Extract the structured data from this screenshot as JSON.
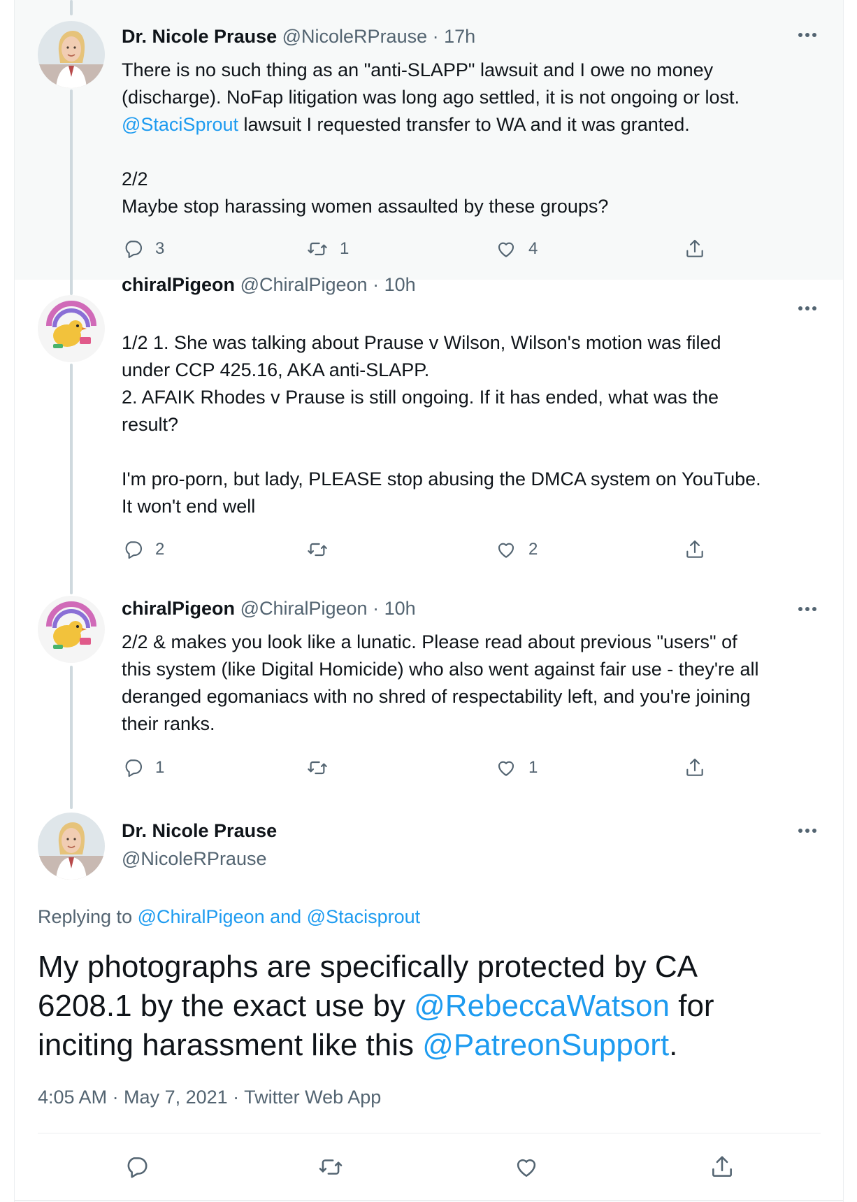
{
  "colors": {
    "link": "#1d9bf0",
    "secondary_text": "#536471",
    "primary_text": "#0f1419",
    "highlight_bg": "#f7f9f9"
  },
  "tweets": [
    {
      "name": "Dr. Nicole Prause",
      "handle": "@NicoleRPrause",
      "separator": "·",
      "time": "17h",
      "text_a": "There is no such thing as an \"anti-SLAPP\" lawsuit and I owe no money\n(discharge). NoFap litigation was long ago settled, it is not ongoing or lost.\n",
      "mention": "@StaciSprout",
      "text_b": " lawsuit I requested transfer to WA and it was granted.\n\n2/2\nMaybe stop harassing women assaulted by these groups?",
      "replies": "3",
      "retweets": "1",
      "likes": "4"
    },
    {
      "name": "chiralPigeon",
      "handle": "@ChiralPigeon",
      "separator": "·",
      "time": "10h",
      "text": "1/2 1. She was talking about Prause v Wilson, Wilson's motion was filed\nunder CCP 425.16, AKA anti-SLAPP.\n2. AFAIK Rhodes v Prause is still ongoing. If it has ended, what was the\nresult?\n\nI'm pro-porn, but lady, PLEASE stop abusing the DMCA system on YouTube.\nIt won't end well",
      "replies": "2",
      "retweets": "",
      "likes": "2"
    },
    {
      "name": "chiralPigeon",
      "handle": "@ChiralPigeon",
      "separator": "·",
      "time": "10h",
      "text": "2/2 & makes you look like a lunatic. Please read about previous \"users\" of\nthis system (like Digital Homicide) who also went against fair use - they're all\nderanged egomaniacs with no shred of respectability left, and you're joining\ntheir ranks.",
      "replies": "1",
      "retweets": "",
      "likes": "1"
    }
  ],
  "focus": {
    "name": "Dr. Nicole Prause",
    "handle": "@NicoleRPrause",
    "replying_prefix": "Replying to ",
    "replying_to_1": "@ChiralPigeon",
    "replying_and": " and ",
    "replying_to_2": "@Stacisprout",
    "text_1": "My photographs are specifically protected by CA\n6208.1 by the exact use by ",
    "mention_1": "@RebeccaWatson",
    "text_2": " for\ninciting harassment like this ",
    "mention_2": "@PatreonSupport",
    "text_3": ".",
    "timestamp": "4:05 AM · May 7, 2021 · Twitter Web App"
  },
  "icons": [
    "reply-icon",
    "retweet-icon",
    "like-icon",
    "share-icon",
    "more-icon"
  ]
}
